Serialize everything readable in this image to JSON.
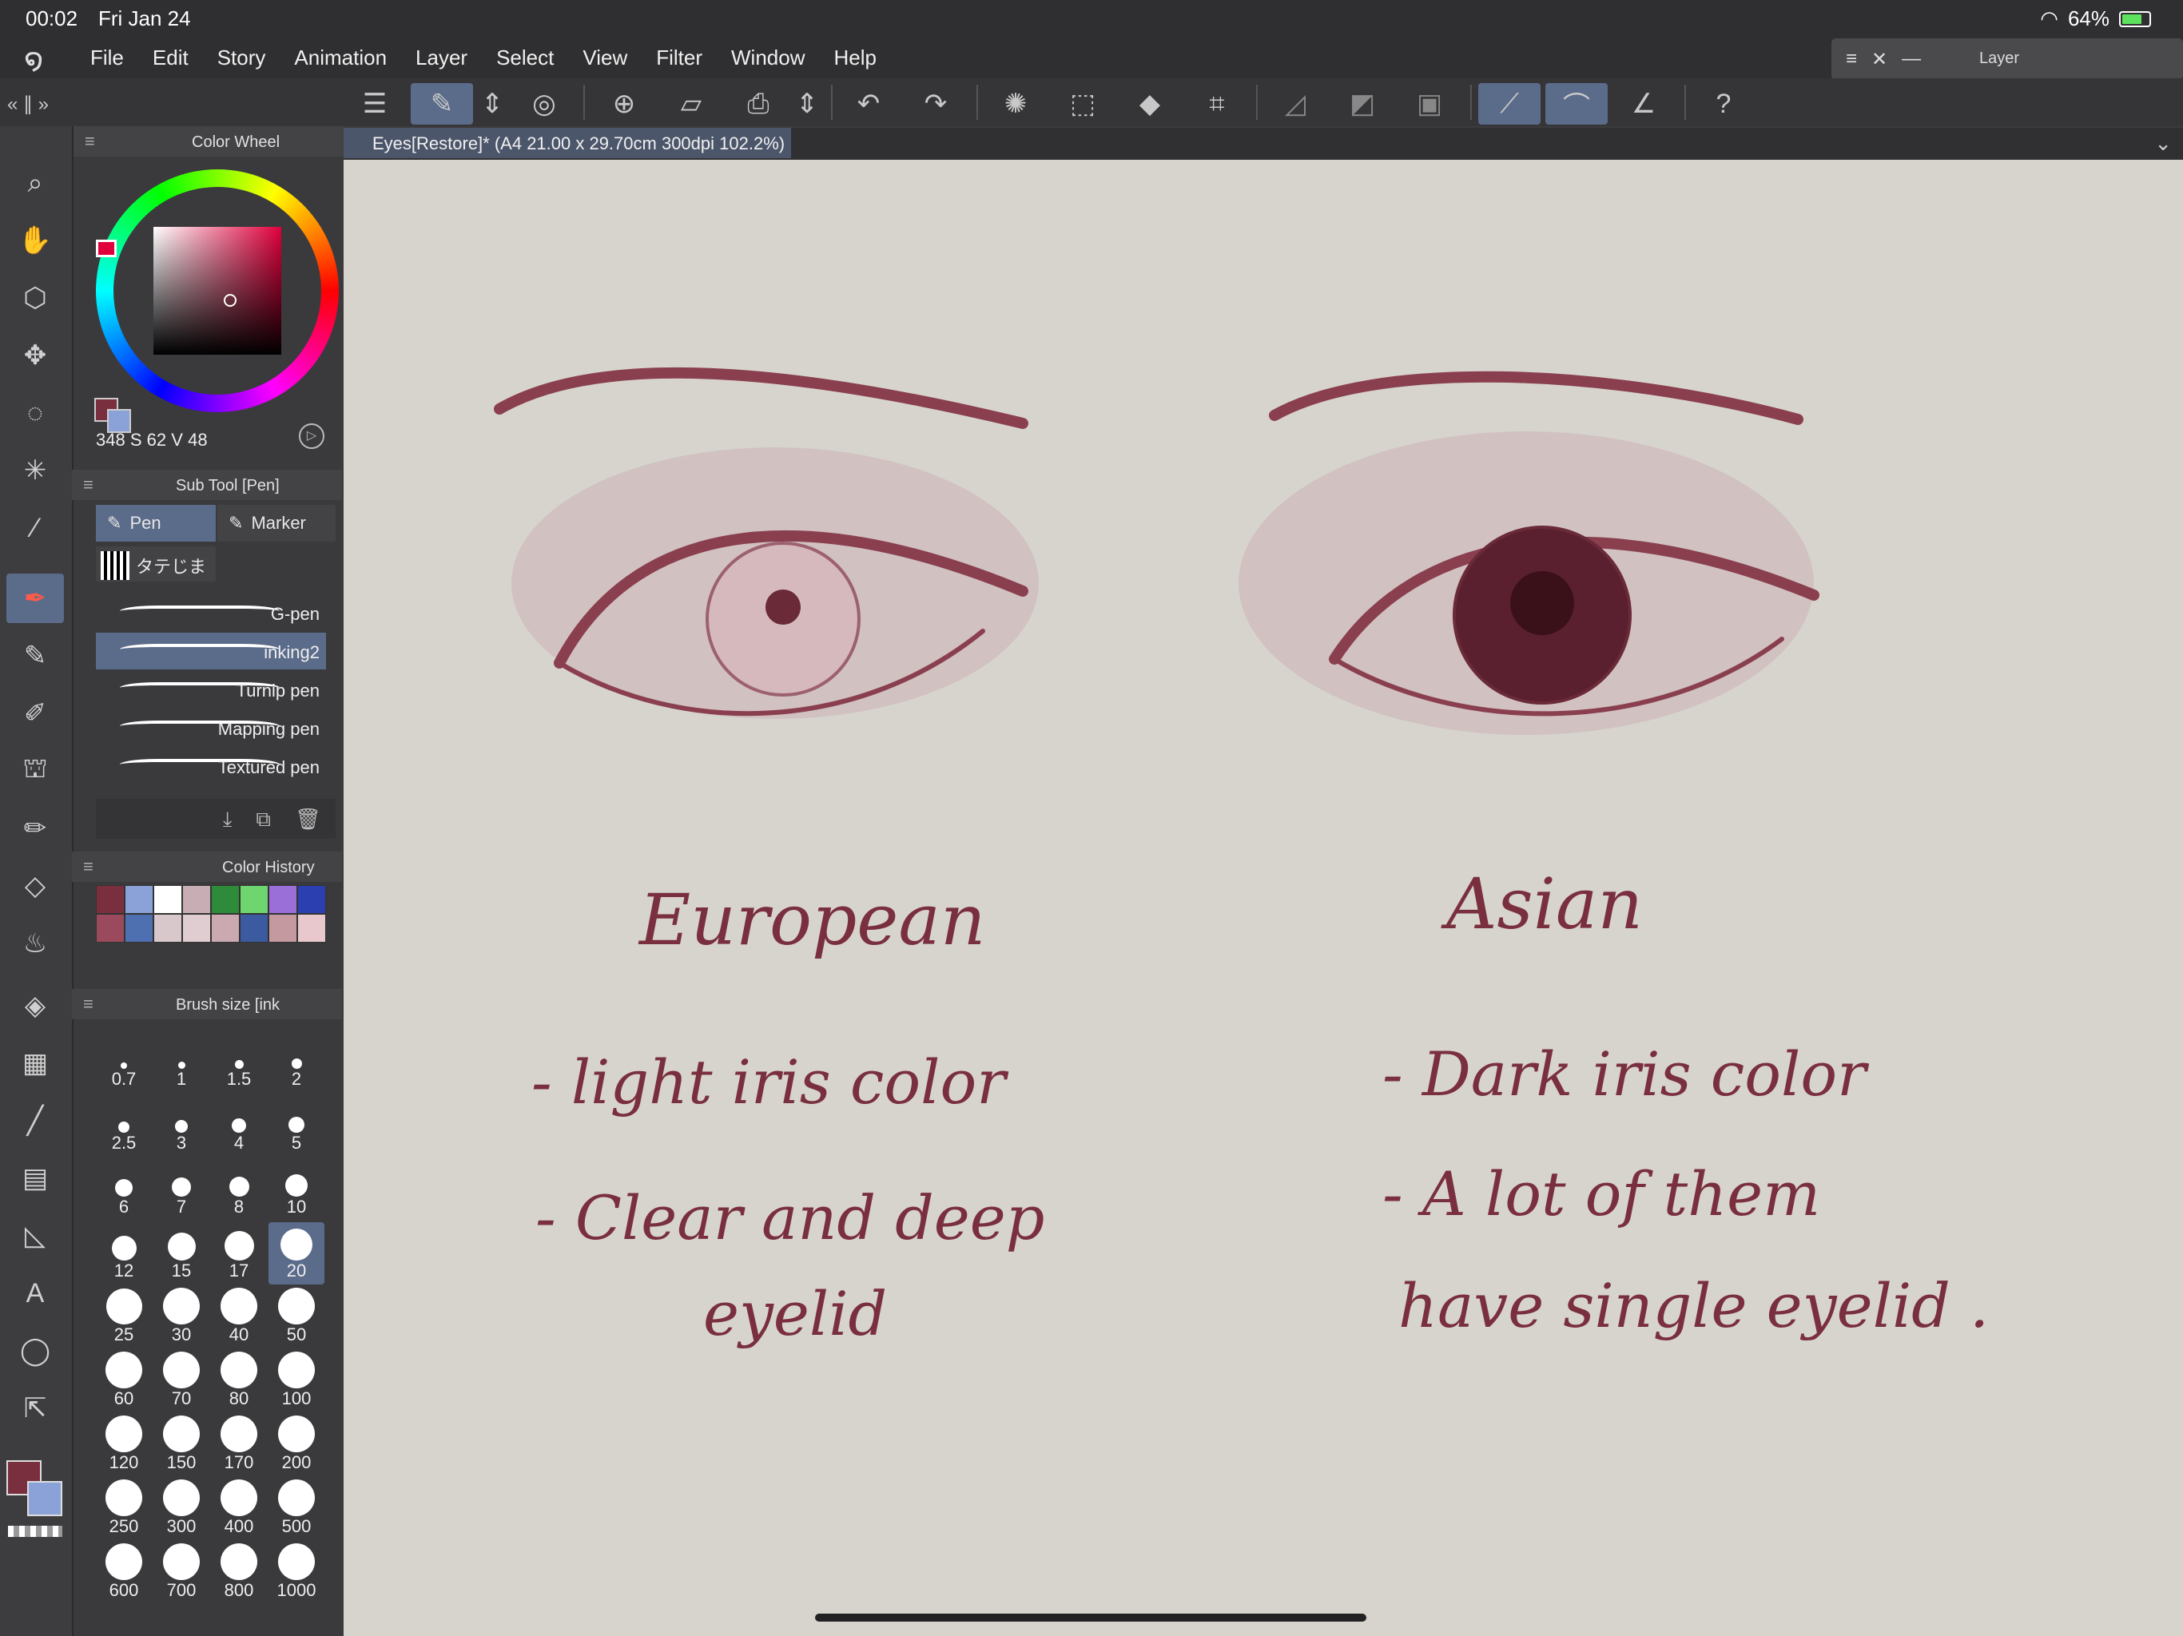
{
  "status": {
    "time": "00:02",
    "date": "Fri Jan 24",
    "battery": "64%",
    "battery_level": 0.64
  },
  "menu": [
    "File",
    "Edit",
    "Story",
    "Animation",
    "Layer",
    "Select",
    "View",
    "Filter",
    "Window",
    "Help"
  ],
  "layer_window": {
    "title": "Layer"
  },
  "color_wheel": {
    "title": "Color Wheel",
    "h": "348",
    "s_label": "S",
    "s": "62",
    "v_label": "V",
    "v": "48",
    "main_color": "#7a2f3e",
    "sub_color": "#8aa2d8"
  },
  "subtool": {
    "title": "Sub Tool [Pen]",
    "tabs": [
      "Pen",
      "Marker"
    ],
    "group": "タテじま",
    "brushes": [
      "G-pen",
      "inking2",
      "Turnip pen",
      "Mapping pen",
      "Textured pen"
    ],
    "selected": "inking2"
  },
  "color_history": {
    "title": "Color History",
    "swatches": [
      "#7a2f3e",
      "#8aa2d8",
      "#ffffff",
      "#c8aeb4",
      "#2e8b3a",
      "#6fd66f",
      "#9b6fd8",
      "#2c3fb0",
      "#9a4a5c",
      "#4e6fb0",
      "#d8c8cc",
      "#e0cdd1",
      "#caa9b0",
      "#3b5aa0",
      "#c49aa0",
      "#e8c8cc"
    ]
  },
  "brush_size": {
    "title": "Brush size [ink",
    "sizes": [
      "0.7",
      "1",
      "1.5",
      "2",
      "2.5",
      "3",
      "4",
      "5",
      "6",
      "7",
      "8",
      "10",
      "12",
      "15",
      "17",
      "20",
      "25",
      "30",
      "40",
      "50",
      "60",
      "70",
      "80",
      "100",
      "120",
      "150",
      "170",
      "200",
      "250",
      "300",
      "400",
      "500",
      "600",
      "700",
      "800",
      "1000"
    ],
    "selected": "20"
  },
  "canvas": {
    "tab": "Eyes[Restore]* (A4 21.00 x 29.70cm 300dpi 102.2%)"
  },
  "drawing": {
    "left_title": "European",
    "left_l1": "- light iris color",
    "left_l2a": "- Clear and deep",
    "left_l2b": "eyelid",
    "right_title": "Asian",
    "right_l1": "- Dark iris color",
    "right_l2a": "- A lot of them",
    "right_l2b": "have single eyelid ."
  }
}
